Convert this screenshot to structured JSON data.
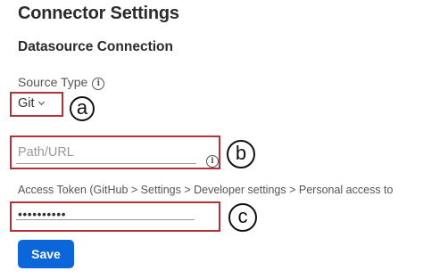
{
  "header": {
    "title": "Connector Settings",
    "section": "Datasource Connection"
  },
  "source_type": {
    "label": "Source Type",
    "info_glyph": "i",
    "selected": "Git",
    "chevron_icon": "chevron-down-icon"
  },
  "path": {
    "placeholder": "Path/URL",
    "value": "",
    "info_glyph": "i"
  },
  "token": {
    "label": "Access Token (GitHub > Settings > Developer settings > Personal access to",
    "value": "••••••••••"
  },
  "actions": {
    "save_label": "Save"
  },
  "annotations": {
    "a": "a",
    "b": "b",
    "c": "c",
    "box_color": "#b3323a"
  },
  "colors": {
    "primary": "#0a66d9"
  }
}
